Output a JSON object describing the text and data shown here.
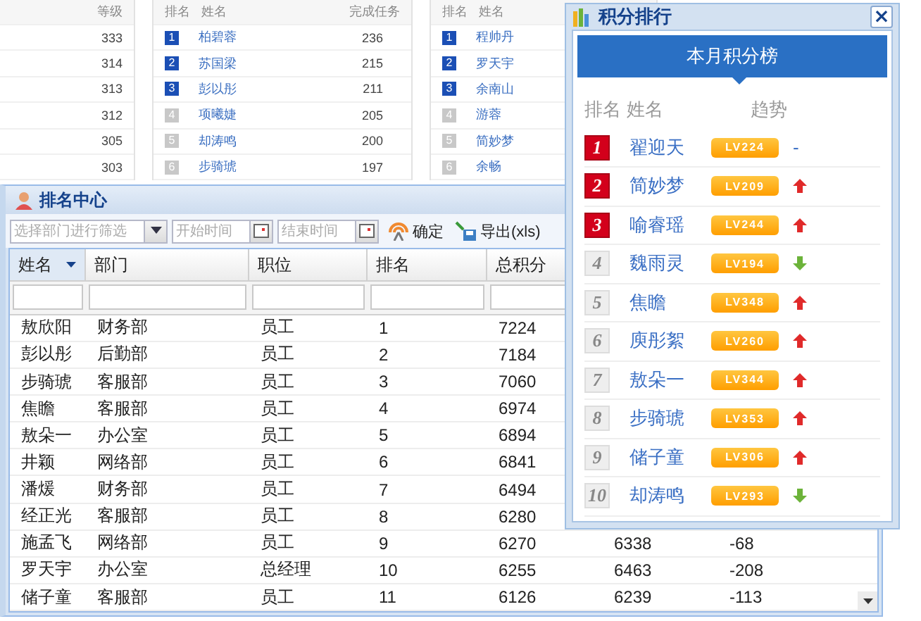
{
  "background_panels": [
    {
      "columns": [
        "等级"
      ],
      "rows": [
        [
          "333"
        ],
        [
          "314"
        ],
        [
          "313"
        ],
        [
          "312"
        ],
        [
          "305"
        ],
        [
          "303"
        ]
      ]
    },
    {
      "columns": [
        "排名",
        "姓名",
        "完成任务"
      ],
      "rows": [
        {
          "rank": "1",
          "top": true,
          "name": "柏碧蓉",
          "value": "236"
        },
        {
          "rank": "2",
          "top": true,
          "name": "苏国梁",
          "value": "215"
        },
        {
          "rank": "3",
          "top": true,
          "name": "彭以彤",
          "value": "211"
        },
        {
          "rank": "4",
          "top": false,
          "name": "项曦婕",
          "value": "205"
        },
        {
          "rank": "5",
          "top": false,
          "name": "却涛鸣",
          "value": "200"
        },
        {
          "rank": "6",
          "top": false,
          "name": "步骑琥",
          "value": "197"
        }
      ]
    },
    {
      "columns": [
        "排名",
        "姓名"
      ],
      "rows": [
        {
          "rank": "1",
          "top": true,
          "name": "程帅丹"
        },
        {
          "rank": "2",
          "top": true,
          "name": "罗天宇"
        },
        {
          "rank": "3",
          "top": true,
          "name": "余南山"
        },
        {
          "rank": "4",
          "top": false,
          "name": "游蓉"
        },
        {
          "rank": "5",
          "top": false,
          "name": "简妙梦"
        },
        {
          "rank": "6",
          "top": false,
          "name": "余畅"
        }
      ]
    }
  ],
  "ranking_window": {
    "title": "排名中心",
    "toolbar": {
      "department": {
        "placeholder": "选择部门进行筛选"
      },
      "start": {
        "placeholder": "开始时间"
      },
      "end": {
        "placeholder": "结束时间"
      },
      "confirm": "确定",
      "export": "导出(xls)"
    },
    "columns": [
      "姓名",
      "部门",
      "职位",
      "排名",
      "总积分"
    ],
    "rows": [
      {
        "cells": [
          "敖欣阳",
          "财务部",
          "员工",
          "1",
          "7224"
        ]
      },
      {
        "cells": [
          "彭以彤",
          "后勤部",
          "员工",
          "2",
          "7184"
        ]
      },
      {
        "cells": [
          "步骑琥",
          "客服部",
          "员工",
          "3",
          "7060"
        ]
      },
      {
        "cells": [
          "焦瞻",
          "客服部",
          "员工",
          "4",
          "6974"
        ]
      },
      {
        "cells": [
          "敖朵一",
          "办公室",
          "员工",
          "5",
          "6894"
        ]
      },
      {
        "cells": [
          "井颖",
          "网络部",
          "员工",
          "6",
          "6841"
        ]
      },
      {
        "cells": [
          "潘煖",
          "财务部",
          "员工",
          "7",
          "6494"
        ]
      },
      {
        "cells": [
          "经正光",
          "客服部",
          "员工",
          "8",
          "6280"
        ]
      },
      {
        "cells": [
          "施孟飞",
          "网络部",
          "员工",
          "9",
          "6270"
        ],
        "column_6": "6338",
        "column_7": "-68"
      },
      {
        "cells": [
          "罗天宇",
          "办公室",
          "总经理",
          "10",
          "6255"
        ],
        "column_6": "6463",
        "column_7": "-208"
      },
      {
        "cells": [
          "储子童",
          "客服部",
          "员工",
          "11",
          "6126"
        ],
        "column_6": "6239",
        "column_7": "-113"
      }
    ]
  },
  "points_popup": {
    "title": "积分排行",
    "close": "×",
    "banner": "本月积分榜",
    "columns": [
      "排名",
      "姓名",
      "趋势"
    ],
    "rows": [
      {
        "rank": "1",
        "top": true,
        "name": "翟迎天",
        "level": "LV224",
        "trend": {
          "kind": "text",
          "text": "-"
        }
      },
      {
        "rank": "2",
        "top": true,
        "name": "简妙梦",
        "level": "LV209",
        "trend": {
          "kind": "up"
        }
      },
      {
        "rank": "3",
        "top": true,
        "name": "喻睿瑶",
        "level": "LV244",
        "trend": {
          "kind": "up"
        }
      },
      {
        "rank": "4",
        "top": false,
        "name": "魏雨灵",
        "level": "LV194",
        "trend": {
          "kind": "down"
        }
      },
      {
        "rank": "5",
        "top": false,
        "name": "焦瞻",
        "level": "LV348",
        "trend": {
          "kind": "up"
        }
      },
      {
        "rank": "6",
        "top": false,
        "name": "庾彤絮",
        "level": "LV260",
        "trend": {
          "kind": "up"
        }
      },
      {
        "rank": "7",
        "top": false,
        "name": "敖朵一",
        "level": "LV344",
        "trend": {
          "kind": "up"
        }
      },
      {
        "rank": "8",
        "top": false,
        "name": "步骑琥",
        "level": "LV353",
        "trend": {
          "kind": "up"
        }
      },
      {
        "rank": "9",
        "top": false,
        "name": "储子童",
        "level": "LV306",
        "trend": {
          "kind": "up"
        }
      },
      {
        "rank": "10",
        "top": false,
        "name": "却涛鸣",
        "level": "LV293",
        "trend": {
          "kind": "down"
        }
      }
    ]
  }
}
